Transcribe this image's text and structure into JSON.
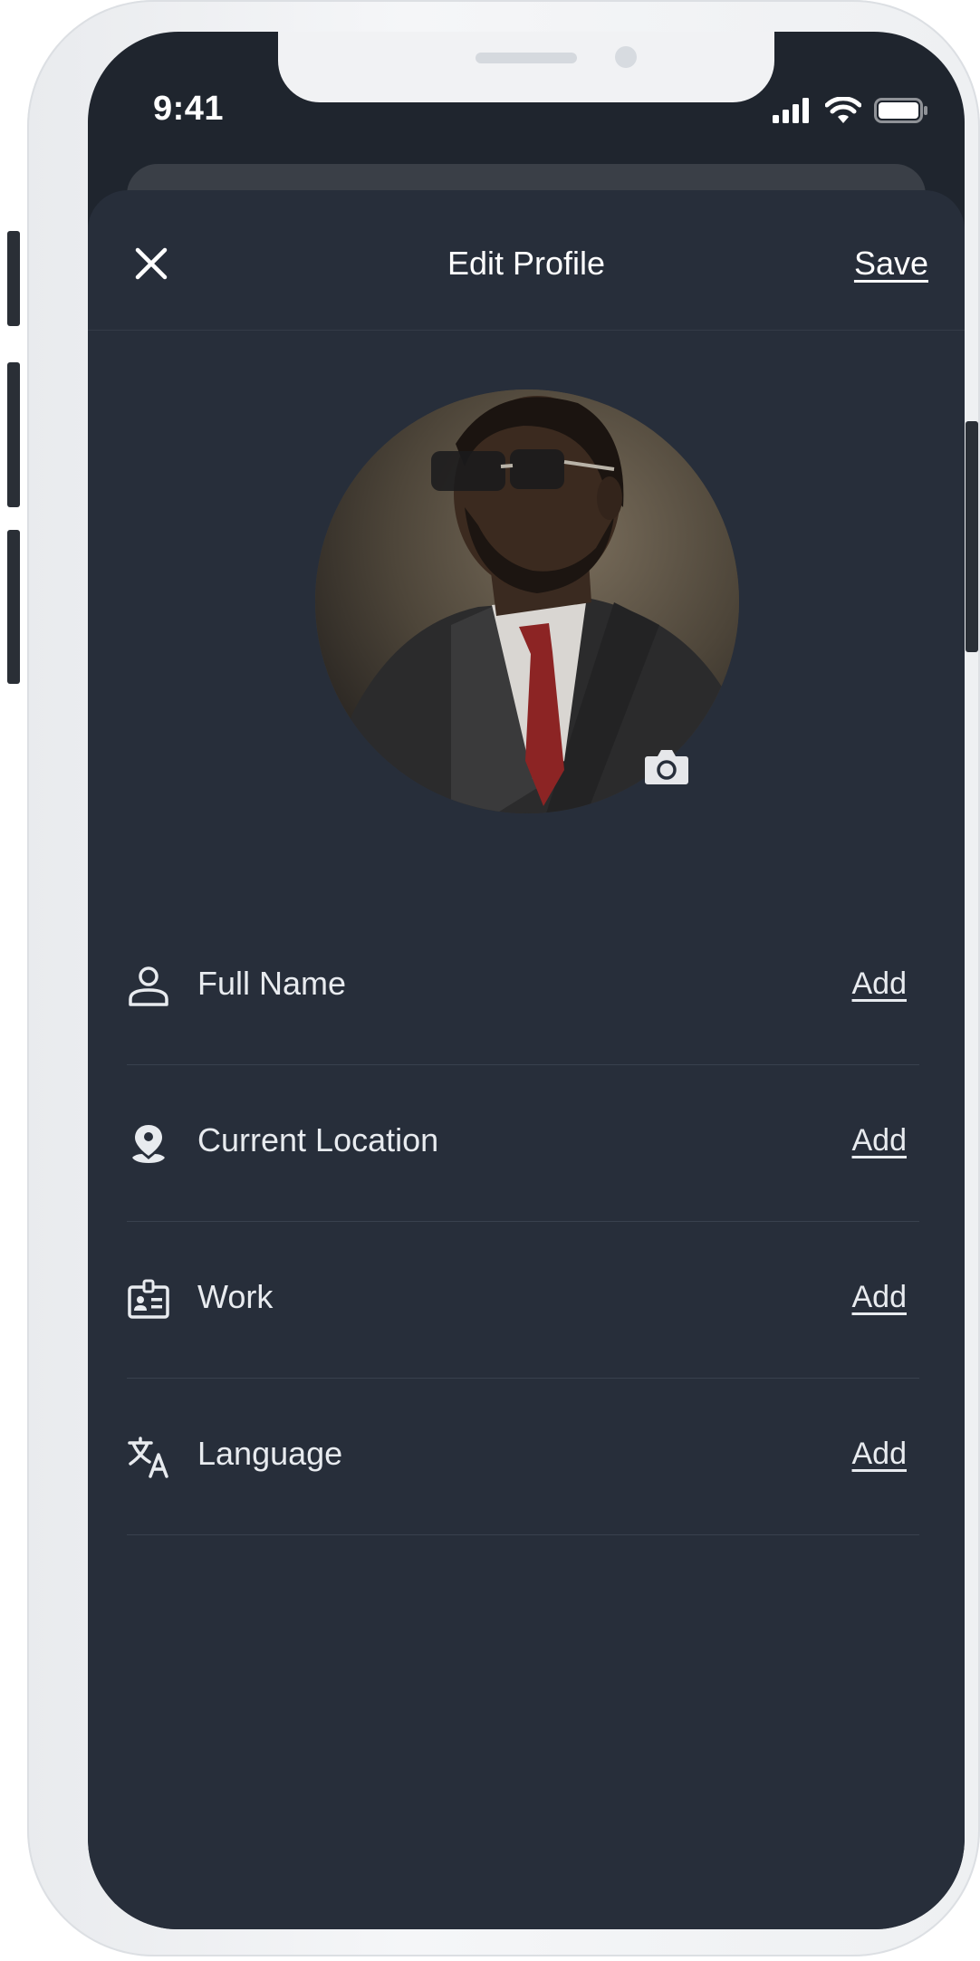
{
  "status_bar": {
    "time": "9:41",
    "icons": [
      "signal-icon",
      "wifi-icon",
      "battery-icon"
    ]
  },
  "header": {
    "close_icon": "close-icon",
    "title": "Edit Profile",
    "save_label": "Save"
  },
  "avatar": {
    "camera_icon": "camera-icon"
  },
  "fields": [
    {
      "icon": "person-icon",
      "label": "Full Name",
      "action": "Add"
    },
    {
      "icon": "location-pin-icon",
      "label": "Current Location",
      "action": "Add"
    },
    {
      "icon": "id-badge-icon",
      "label": "Work",
      "action": "Add"
    },
    {
      "icon": "translate-icon",
      "label": "Language",
      "action": "Add"
    }
  ],
  "colors": {
    "sheet_bg": "#272e3a",
    "screen_bg": "#1f252e",
    "text": "#e8ebef",
    "divider": "#39414e"
  }
}
